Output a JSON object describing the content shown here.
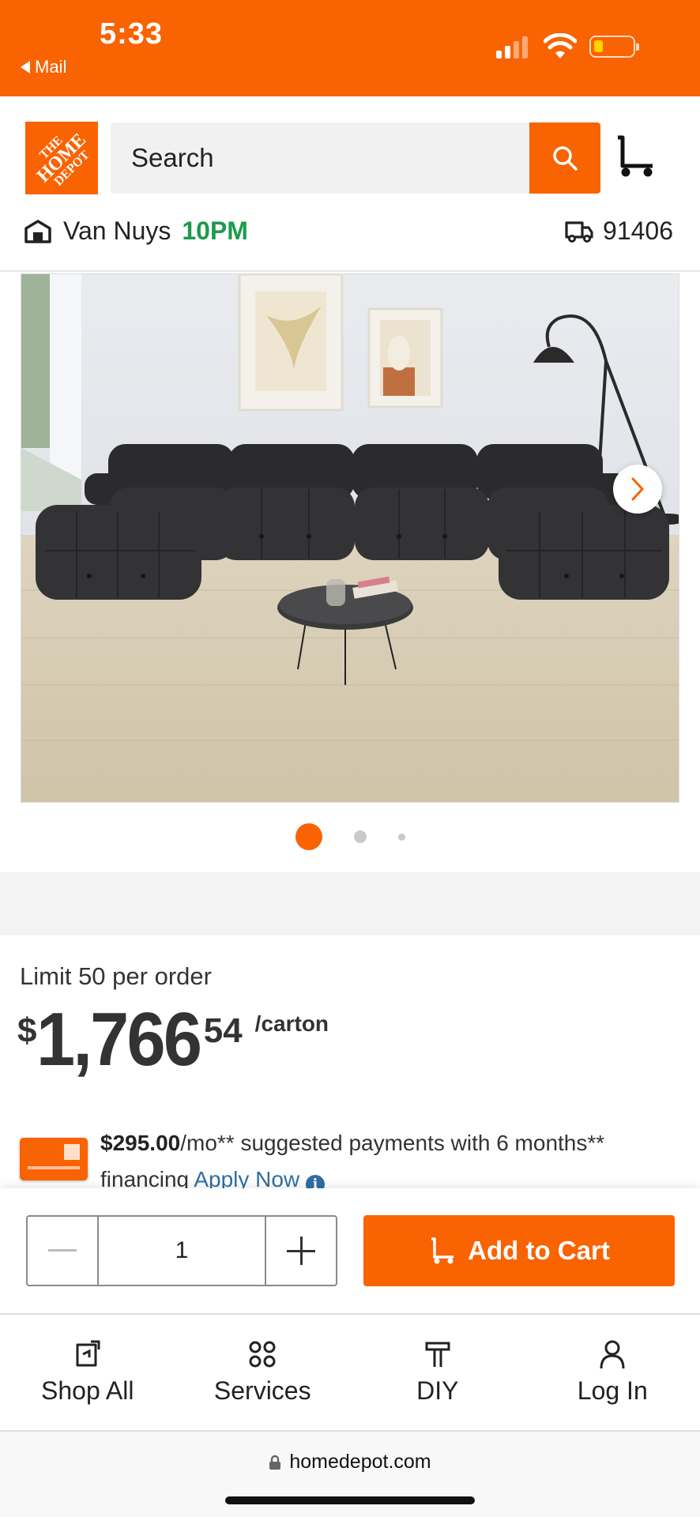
{
  "status_bar": {
    "time": "5:33",
    "back_app": "Mail"
  },
  "header": {
    "logo_text": "THE HOME DEPOT",
    "search_placeholder": "Search",
    "store_name": "Van Nuys",
    "store_close_time": "10PM",
    "delivery_zip": "91406"
  },
  "carousel": {
    "image_alt": "Black modular sectional sofa in living room",
    "total_slides": 3,
    "active_slide": 1
  },
  "pricing": {
    "limit_text": "Limit 50 per order",
    "currency_symbol": "$",
    "price_dollars": "1,766",
    "price_cents": "54",
    "price_unit": "/carton",
    "financing_amount": "$295.00",
    "financing_text": "/mo** suggested payments with 6 months** financing",
    "apply_link": "Apply Now"
  },
  "cart_bar": {
    "quantity": "1",
    "add_to_cart_label": "Add to Cart"
  },
  "bottom_nav": {
    "items": [
      {
        "label": "Shop All",
        "icon": "shop-all-icon"
      },
      {
        "label": "Services",
        "icon": "services-icon"
      },
      {
        "label": "DIY",
        "icon": "diy-icon"
      },
      {
        "label": "Log In",
        "icon": "user-icon"
      }
    ]
  },
  "browser": {
    "url": "homedepot.com"
  },
  "colors": {
    "brand_orange": "#f96302",
    "store_green": "#1d9a4e",
    "link_blue": "#2f6ea3"
  }
}
